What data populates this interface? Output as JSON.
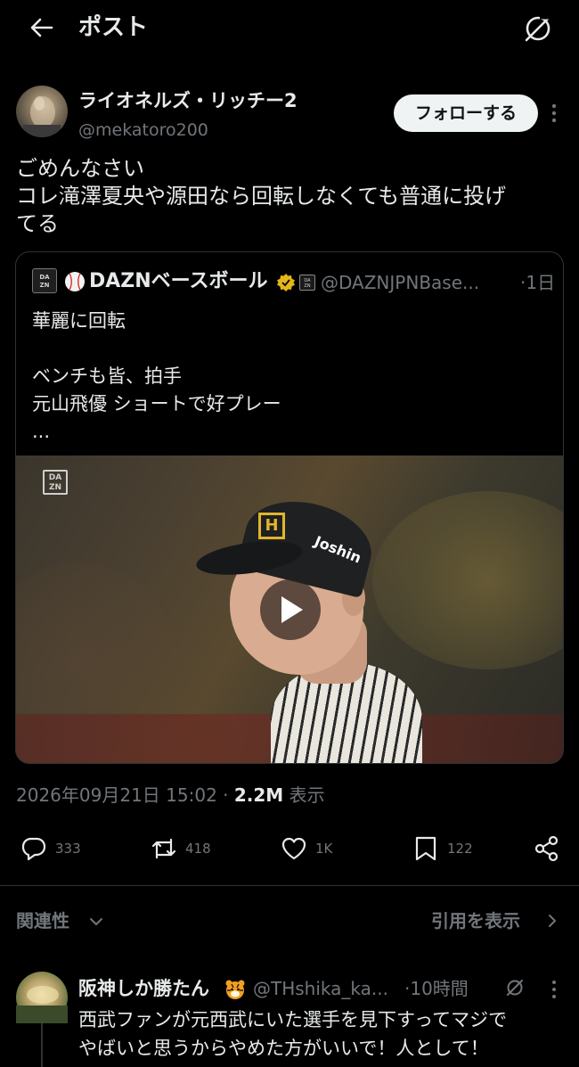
{
  "header": {
    "title": "ポスト"
  },
  "post": {
    "author_name": "ライオネルズ・リッチー2",
    "author_handle": "@mekatoro200",
    "follow_label": "フォローする",
    "text_lines": [
      "ごめんなさい",
      "コレ滝澤夏央や源田なら回転しなくても普通に投げ",
      "てる"
    ],
    "timestamp": "2026年09月21日 15:02",
    "views_count": "2.2M",
    "views_label": "表示"
  },
  "quoted": {
    "name": "DAZNベースボール",
    "handle": "@DAZNJPNBase...",
    "time": "·1日",
    "text_lines": [
      "華麗に回転",
      "",
      "ベンチも皆、拍手",
      "元山飛優 ショートで好プレー",
      "..."
    ],
    "video_overlay_logo": "DAZN",
    "cap_text": "Joshin",
    "cap_logo": "H"
  },
  "actions": {
    "reply": "333",
    "repost": "418",
    "like": "1K",
    "bookmark": "122"
  },
  "related": {
    "sort_label": "関連性",
    "quotes_label": "引用を表示"
  },
  "reply": {
    "name": "阪神しか勝たん",
    "handle": "@THshika_ka...",
    "time": "·10時間",
    "text_lines": [
      "西武ファンが元西武にいた選手を見下すってマジで",
      "やばいと思うからやめた方がいいで！人として！"
    ]
  },
  "colors": {
    "background": "#000000",
    "text_primary": "#e7e9ea",
    "text_secondary": "#71767b",
    "border": "#2f3336",
    "follow_button_bg": "#eff3f4",
    "verified_gold": "#e2b719"
  },
  "icons": {
    "back": "arrow-left-icon",
    "grok": "grok-icon",
    "more": "more-vertical-icon",
    "reply": "comment-icon",
    "repost": "repost-icon",
    "like": "heart-icon",
    "bookmark": "bookmark-icon",
    "share": "share-icon",
    "verified": "verified-badge-icon",
    "play": "play-icon"
  }
}
